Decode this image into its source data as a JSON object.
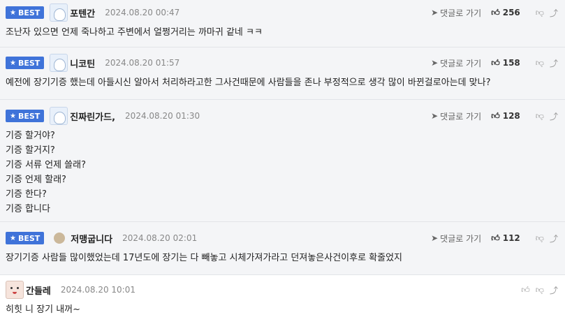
{
  "best_label": "BEST",
  "reply_label": "댓글로 가기",
  "comments": [
    {
      "best": true,
      "nick": "포텐간",
      "date": "2024.08.20 00:47",
      "likes": "256",
      "lines": [
        "조난자 있으면 언제 죽나하고 주변에서 얼쩡거리는 까마귀 같네 ㅋㅋ"
      ]
    },
    {
      "best": true,
      "nick": "니코틴",
      "date": "2024.08.20 01:57",
      "likes": "158",
      "lines": [
        "예전에 장기기증 했는데 아들시신 알아서 처리하라고한 그사건때문에 사람들을 존나 부정적으로 생각 많이 바뀐걸로아는데 맞나?"
      ]
    },
    {
      "best": true,
      "nick": "진짜린가드,",
      "date": "2024.08.20 01:30",
      "likes": "128",
      "lines": [
        "기증 할거야?",
        "기증 할거지?",
        "기증 서류 언제 쓸래?",
        "기증 언제 할래?",
        "기증 한다?",
        "기증 합니다"
      ]
    },
    {
      "best": true,
      "nick": "저맹굽니다",
      "date": "2024.08.20 02:01",
      "likes": "112",
      "lines": [
        "장기기증 사람들 많이했었는데 17년도에 장기는 다 빼놓고 시체가져가라고 던져놓은사건이후로 확줄었지"
      ]
    },
    {
      "best": false,
      "nick": "간들레",
      "date": "2024.08.20 10:01",
      "likes": "",
      "lines": [
        "히힛 니 장기 내꺼~"
      ]
    }
  ]
}
